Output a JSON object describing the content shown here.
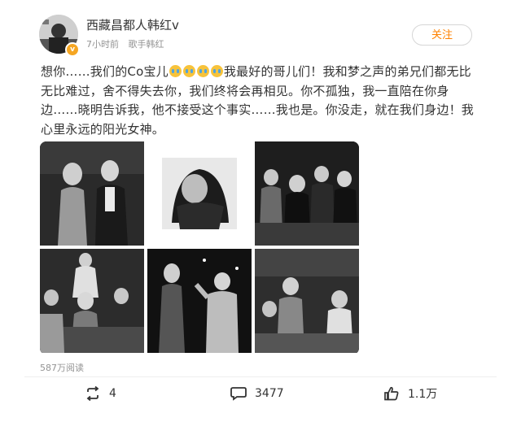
{
  "user": {
    "name": "西藏昌都人韩红v",
    "time": "7小时前",
    "source": "歌手韩红",
    "verified_icon": "v-badge-icon"
  },
  "follow_label": "关注",
  "post": {
    "text_part1": "想你……我们的Co宝儿",
    "emoji_count": 4,
    "emoji_name": "crying-face-icon",
    "text_part2": "我最好的哥儿们！我和梦之声的弟兄们都无比无比难过，舍不得失去你，我们终将会再相见。你不孤独，我一直陪在你身边……晓明告诉我，他不接受这个事实……我也是。你没走，就在我们身边！我心里永远的阳光女神。"
  },
  "photos": [
    {
      "name": "photo-1"
    },
    {
      "name": "photo-2"
    },
    {
      "name": "photo-3"
    },
    {
      "name": "photo-4"
    },
    {
      "name": "photo-5"
    },
    {
      "name": "photo-6"
    }
  ],
  "reads": "587万阅读",
  "actions": {
    "repost_count": "4",
    "comment_count": "3477",
    "like_count": "1.1万"
  },
  "colors": {
    "accent": "#ff8200",
    "meta_text": "#939393",
    "badge": "#f5a623"
  }
}
